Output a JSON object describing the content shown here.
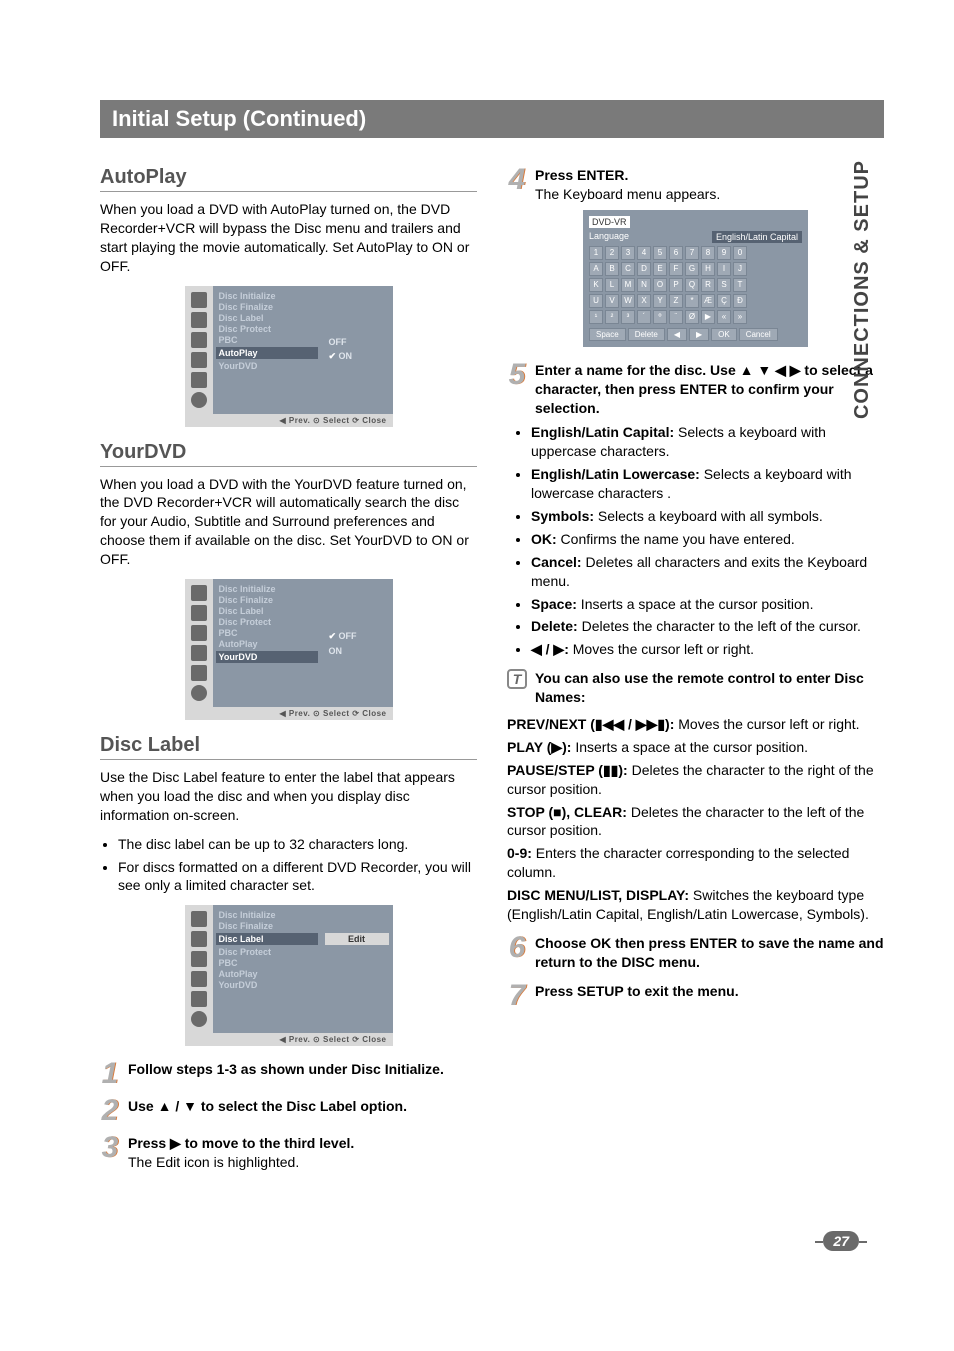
{
  "page_number": "27",
  "side_tab": "CONNECTIONS & SETUP",
  "title": "Initial Setup (Continued)",
  "osd_foot": "◀ Prev.        ⊙ Select      ⟳ Close",
  "osd_items": [
    "Disc Initialize",
    "Disc Finalize",
    "Disc Label",
    "Disc Protect",
    "PBC",
    "AutoPlay",
    "YourDVD"
  ],
  "autoplay": {
    "heading": "AutoPlay",
    "text": "When you load a DVD with AutoPlay turned on, the DVD Recorder+VCR will bypass the Disc menu and trailers and start playing the movie automatically. Set AutoPlay to ON or OFF.",
    "opt_off": "OFF",
    "opt_on": "ON"
  },
  "yourdvd": {
    "heading": "YourDVD",
    "text": "When you load a DVD with the YourDVD feature turned on, the DVD Recorder+VCR will automatically search the disc for your Audio, Subtitle and Surround preferences and choose them if available on the disc. Set YourDVD to ON or OFF.",
    "opt_off": "OFF",
    "opt_on": "ON"
  },
  "disclabel": {
    "heading": "Disc Label",
    "intro": "Use the Disc Label feature to enter the label that appears when you load the disc and when you display disc information on-screen.",
    "b1": "The disc label can be up to 32 characters long.",
    "b2": "For discs formatted on a different DVD Recorder, you will see only a limited character set.",
    "edit": "Edit"
  },
  "steps_left": {
    "s1": "Follow steps 1-3 as shown under Disc Initialize.",
    "s2": "Use ▲ / ▼ to select the Disc Label option.",
    "s3a": "Press ▶ to move to the third level.",
    "s3b": "The Edit icon is highlighted."
  },
  "steps_right": {
    "s4a": "Press ENTER.",
    "s4b": "The Keyboard menu appears.",
    "s5": "Enter a name for the disc. Use ▲ ▼ ◀ ▶ to select a character, then press ENTER to confirm your selection.",
    "s6": "Choose OK then press ENTER to save the name and return to the DISC menu.",
    "s7": "Press SETUP to exit the menu."
  },
  "kb": {
    "field": "DVD-VR",
    "lang": "Language",
    "mode": "English/Latin Capital",
    "row1": [
      "1",
      "2",
      "3",
      "4",
      "5",
      "6",
      "7",
      "8",
      "9",
      "0"
    ],
    "row2": [
      "A",
      "B",
      "C",
      "D",
      "E",
      "F",
      "G",
      "H",
      "I",
      "J"
    ],
    "row3": [
      "K",
      "L",
      "M",
      "N",
      "O",
      "P",
      "Q",
      "R",
      "S",
      "T"
    ],
    "row4": [
      "U",
      "V",
      "W",
      "X",
      "Y",
      "Z",
      "*",
      "Æ",
      "Ç",
      "Ð"
    ],
    "row5": [
      "¹",
      "²",
      "³",
      "´",
      "º",
      "¨",
      "Ø",
      "▶",
      "«",
      "»"
    ],
    "bot": [
      "Space",
      "Delete",
      "◀",
      "▶",
      "OK",
      "Cancel"
    ]
  },
  "kb_options": {
    "cap_l": "English/Latin Capital:",
    "cap_t": " Selects a keyboard with uppercase characters.",
    "low_l": "English/Latin Lowercase:",
    "low_t": " Selects a keyboard with lowercase characters .",
    "sym_l": "Symbols:",
    "sym_t": " Selects a keyboard with all symbols.",
    "ok_l": "OK:",
    "ok_t": " Confirms the name you have entered.",
    "can_l": "Cancel:",
    "can_t": " Deletes all characters and exits the Keyboard menu.",
    "spc_l": "Space:",
    "spc_t": " Inserts a space at the cursor position.",
    "del_l": "Delete:",
    "del_t": " Deletes the character to the left of the cursor.",
    "lr_l": "◀ / ▶:",
    "lr_t": " Moves the cursor left or right."
  },
  "tip_text": "You can also use the remote control to enter Disc Names:",
  "remote": {
    "r1a": "PREV/NEXT (▮◀◀ / ▶▶▮):",
    "r1b": " Moves the cursor left or right.",
    "r2a": "PLAY (▶):",
    "r2b": " Inserts a space at the cursor position.",
    "r3a": "PAUSE/STEP (▮▮):",
    "r3b": " Deletes the character to the right of the cursor position.",
    "r4a": "STOP (■), CLEAR:",
    "r4b": " Deletes the character to the left of the cursor position.",
    "r5a": "0-9:",
    "r5b": " Enters the character corresponding to the selected column.",
    "r6a": "DISC MENU/LIST, DISPLAY:",
    "r6b": " Switches the keyboard type (English/Latin Capital, English/Latin Lowercase, Symbols)."
  }
}
